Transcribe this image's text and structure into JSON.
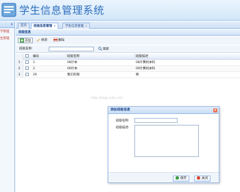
{
  "app": {
    "title": "学生信息管理系统",
    "colors": {
      "title": "#2f6fbd",
      "accent": "#15428b",
      "border": "#99bbe8",
      "danger": "#d9442b",
      "ok": "#3b9c3b"
    }
  },
  "sidebar": {
    "toggle_icon": "double-chevron-left-icon",
    "items": [
      {
        "label": "学管理"
      },
      {
        "label": "生管理"
      }
    ]
  },
  "tabs": [
    {
      "label": "首页",
      "closable": false
    },
    {
      "label": "班级信息管理",
      "closable": true
    },
    {
      "label": "学生信息管理",
      "closable": true
    }
  ],
  "panel": {
    "title": "班级信息"
  },
  "toolbar": {
    "add_label": "添加",
    "edit_label": "修改",
    "delete_label": "删除"
  },
  "search": {
    "label": "班级名称:",
    "value": "",
    "button_label": "搜索"
  },
  "grid": {
    "columns": [
      "编号",
      "班级名称",
      "班级描述"
    ],
    "rows": [
      {
        "num": "1",
        "id": "1",
        "name": "08计本",
        "desc": "08计算机本科"
      },
      {
        "num": "2",
        "id": "2",
        "name": "09计本",
        "desc": "09计算机本科"
      },
      {
        "num": "3",
        "id": "29",
        "name": "我们的啊",
        "desc": "啊"
      }
    ]
  },
  "watermark": "http://blog.csdn.net/",
  "dialog": {
    "title": "添加班级信息",
    "name_label": "班级名称:",
    "name_value": "",
    "desc_label": "班级描述:",
    "desc_value": "",
    "ok_label": "保存",
    "cancel_label": "关闭"
  }
}
